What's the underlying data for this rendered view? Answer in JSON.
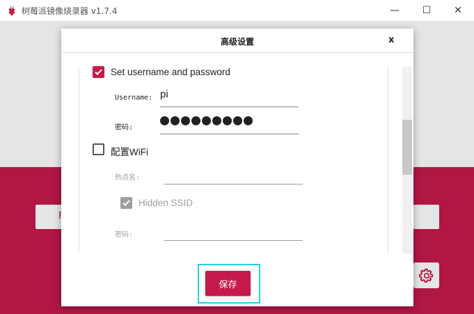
{
  "window": {
    "title": "树莓派镜像烧录器 v1.7.4",
    "minimize_glyph": "—",
    "maximize_glyph": "☐",
    "close_glyph": "✕"
  },
  "dialog": {
    "title": "高级设置",
    "close_label": "x",
    "credentials": {
      "checkbox_label": "Set username and password",
      "checked": true,
      "username_label": "Username:",
      "username_value": "pi",
      "password_label": "密码:",
      "password_masked_length": 9
    },
    "wifi": {
      "checkbox_label": "配置WiFi",
      "checked": false,
      "ssid_label": "热点名:",
      "ssid_value": "",
      "hidden_ssid_label": "Hidden SSID",
      "hidden_ssid_checked": true,
      "password_label": "密码:",
      "password_value": ""
    },
    "save_label": "保存"
  },
  "background": {
    "left_button_text": "F",
    "icon": "gear-icon"
  },
  "colors": {
    "brand": "#c51a4a",
    "focus_ring": "#22d3e0"
  }
}
